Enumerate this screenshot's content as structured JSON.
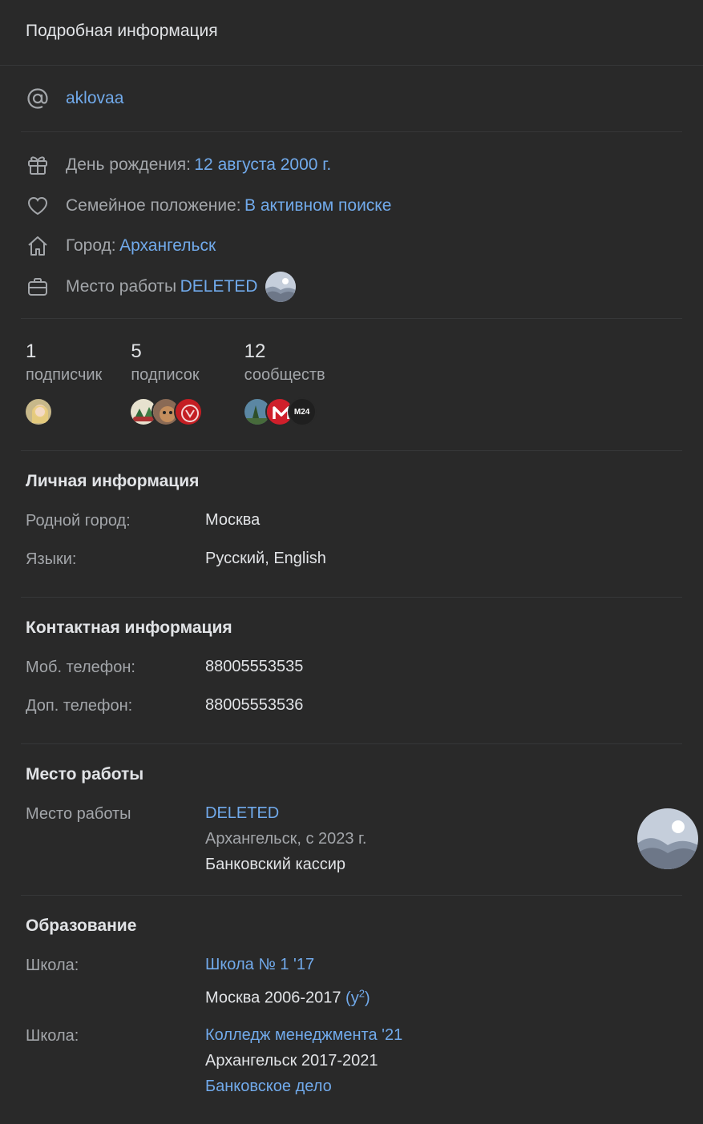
{
  "header": {
    "title": "Подробная информация"
  },
  "handle": {
    "value": "aklovaa"
  },
  "info": {
    "birthday_label": "День рождения:",
    "birthday_value": "12 августа 2000 г.",
    "relationship_label": "Семейное положение:",
    "relationship_value": "В активном поиске",
    "city_label": "Город:",
    "city_value": "Архангельск",
    "work_label": "Место работы",
    "work_value": "DELETED"
  },
  "counters": [
    {
      "num": "1",
      "label": "подписчик"
    },
    {
      "num": "5",
      "label": "подписок"
    },
    {
      "num": "12",
      "label": "сообществ"
    }
  ],
  "community_badge": "M24",
  "personal": {
    "title": "Личная информация",
    "hometown_label": "Родной город:",
    "hometown_value": "Москва",
    "languages_label": "Языки:",
    "languages_value": "Русский, English"
  },
  "contacts": {
    "title": "Контактная информация",
    "mobile_label": "Моб. телефон:",
    "mobile_value": "88005553535",
    "extra_label": "Доп. телефон:",
    "extra_value": "88005553536"
  },
  "career": {
    "title": "Место работы",
    "label": "Место работы",
    "company": "DELETED",
    "location": "Архангельск, с 2023 г.",
    "position": "Банковский кассир"
  },
  "education": {
    "title": "Образование",
    "school1_label": "Школа:",
    "school1_name": "Школа № 1 '17",
    "school1_years": "Москва 2006-2017",
    "school1_class": "(у",
    "school1_class_sup": "2",
    "school1_class_end": ")",
    "school2_label": "Школа:",
    "school2_name": "Колледж менеджмента '21",
    "school2_years": "Архангельск 2017-2021",
    "school2_spec": "Банковское дело"
  }
}
